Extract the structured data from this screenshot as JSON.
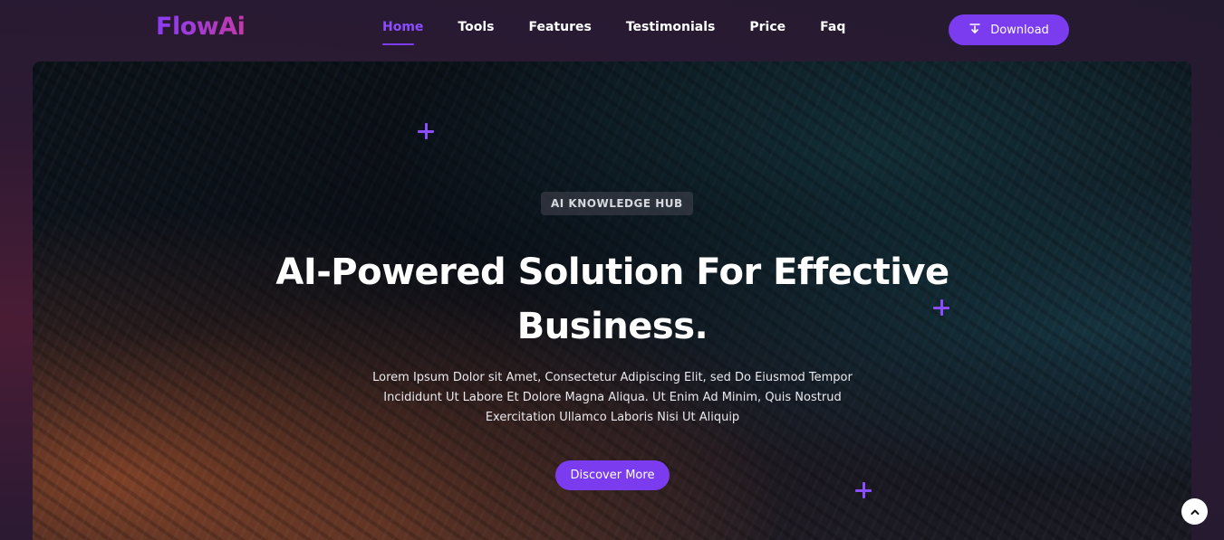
{
  "brand": {
    "name": "FlowAi"
  },
  "nav": {
    "items": [
      {
        "label": "Home",
        "active": true
      },
      {
        "label": "Tools",
        "active": false
      },
      {
        "label": "Features",
        "active": false
      },
      {
        "label": "Testimonials",
        "active": false
      },
      {
        "label": "Price",
        "active": false
      },
      {
        "label": "Faq",
        "active": false
      }
    ]
  },
  "header": {
    "download_label": "Download",
    "download_icon": "download-icon"
  },
  "hero": {
    "badge": "AI KNOWLEDGE HUB",
    "headline_line1": "AI-Powered Solution For Effective",
    "headline_line2": "Business.",
    "subtext_line1": "Lorem Ipsum Dolor sit Amet, Consectetur Adipiscing Elit, sed Do Eiusmod Tempor",
    "subtext_line2": "Incididunt Ut Labore Et Dolore Magna Aliqua. Ut Enim Ad Minim, Quis Nostrud",
    "subtext_line3": "Exercitation Ullamco Laboris Nisi Ut Aliquip",
    "cta_label": "Discover More"
  },
  "colors": {
    "accent": "#7b3cf0",
    "nav_active": "#8b4dff",
    "background": "#2a1830"
  },
  "icons": {
    "scroll_top": "chevron-up-icon",
    "sparkle": "plus-sparkle-icon"
  }
}
